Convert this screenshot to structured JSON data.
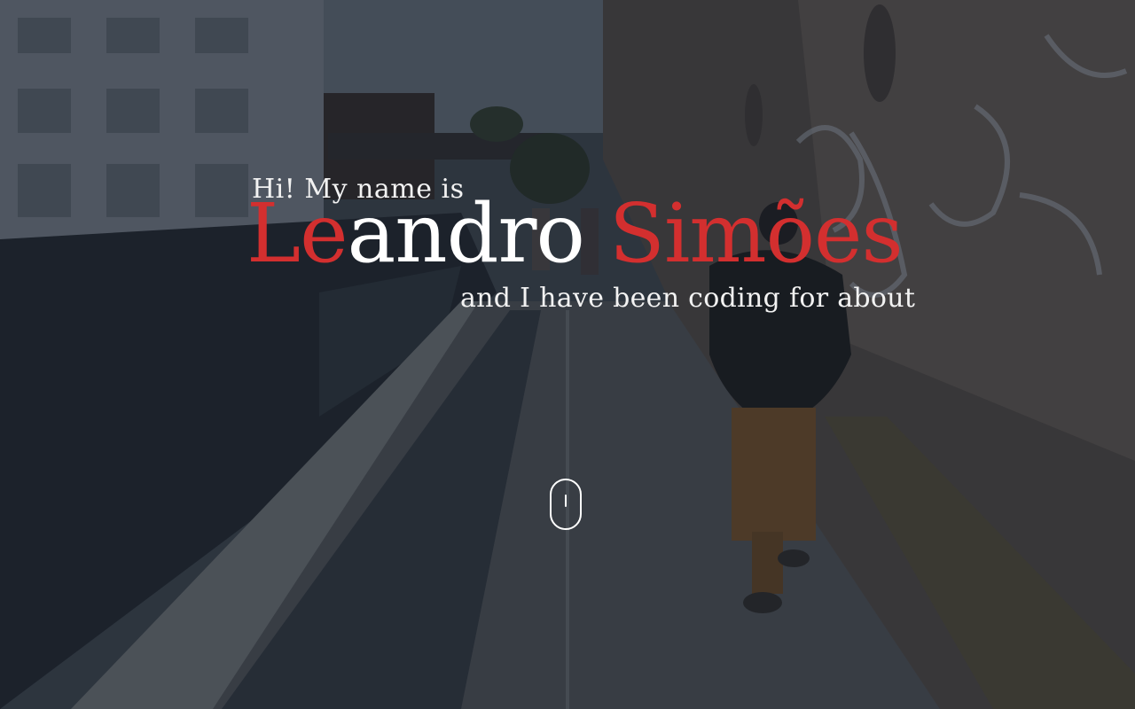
{
  "hero": {
    "greeting": "Hi! My name is",
    "name_part1": "Le",
    "name_part2": "andro",
    "name_part3": "Simões",
    "tagline": "and I have been coding for about"
  },
  "scroll_indicator": {
    "icon": "mouse-scroll-icon"
  },
  "colors": {
    "accent": "#d32f2f",
    "text": "#ffffff",
    "overlay": "#1c2430"
  }
}
